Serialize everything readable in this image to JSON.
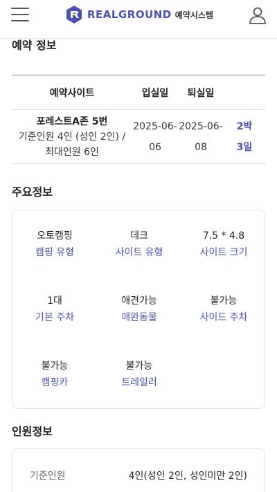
{
  "header": {
    "brand": "REALGROUND",
    "subtitle": "예약시스템",
    "menu_icon": "hamburger-menu-icon",
    "user_icon": "user-profile-icon",
    "accent": "#4a52b3"
  },
  "reservation": {
    "section_title": "예약 정보",
    "columns": [
      "예약사이트",
      "입실일",
      "퇴실일"
    ],
    "row": {
      "site_name": "포레스트A존 5번",
      "capacity_line1": "기준인원 4인 (성인 2인) /",
      "capacity_line2": "최대인원 6인",
      "checkin_line1": "2025-06-",
      "checkin_line2": "06",
      "checkout_line1": "2025-06-",
      "checkout_line2": "08",
      "nights_line1": "2박",
      "nights_line2": "3일"
    }
  },
  "main_info": {
    "section_title": "주요정보",
    "items": [
      {
        "value": "오토캠핑",
        "label": "캠핑 유형"
      },
      {
        "value": "데크",
        "label": "사이트 유형"
      },
      {
        "value": "7.5 * 4.8",
        "label": "사이트 크기"
      },
      {
        "value": "1대",
        "label": "기본 주차"
      },
      {
        "value": "애견가능",
        "label": "애완동물"
      },
      {
        "value": "불가능",
        "label": "사이드 주차"
      },
      {
        "value": "불가능",
        "label": "캠핑카"
      },
      {
        "value": "불가능",
        "label": "트레일러"
      }
    ]
  },
  "people_info": {
    "section_title": "인원정보",
    "label": "기준인원",
    "value": "4인(성인 2인, 성인미만 2인)"
  }
}
